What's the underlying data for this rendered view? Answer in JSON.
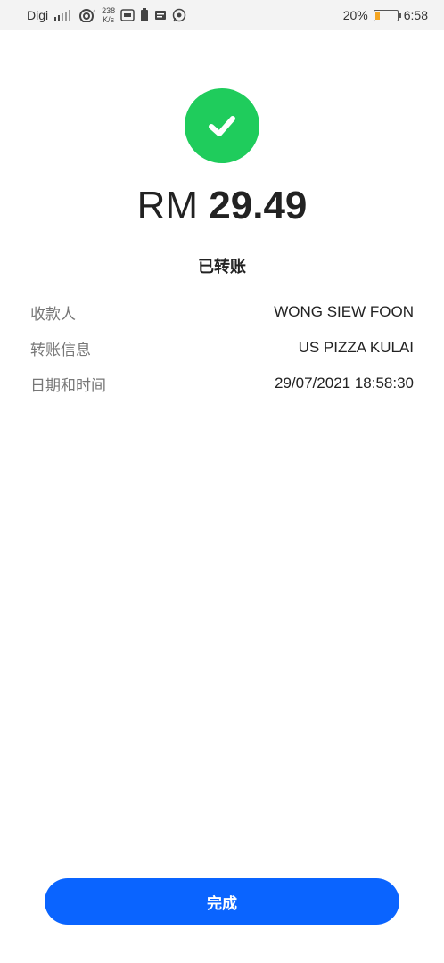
{
  "status_bar": {
    "carrier": "Digi",
    "net_speed_value": "238",
    "net_speed_unit": "K/s",
    "battery_percent": "20%",
    "battery_level": 0.2,
    "time": "6:58"
  },
  "receipt": {
    "currency": "RM",
    "amount": "29.49",
    "status": "已转账",
    "rows": [
      {
        "label": "收款人",
        "value": "WONG SIEW FOON"
      },
      {
        "label": "转账信息",
        "value": "US PIZZA KULAI"
      },
      {
        "label": "日期和时间",
        "value": "29/07/2021 18:58:30"
      }
    ]
  },
  "actions": {
    "done_label": "完成"
  },
  "colors": {
    "success": "#1fcc5c",
    "primary": "#0a64ff",
    "battery_low": "#f5a623"
  },
  "icons": [
    "signal-icon",
    "wifi-icon",
    "sim-icon",
    "battery-saver-icon",
    "message-icon",
    "whatsapp-icon",
    "battery-icon",
    "checkmark-icon"
  ]
}
